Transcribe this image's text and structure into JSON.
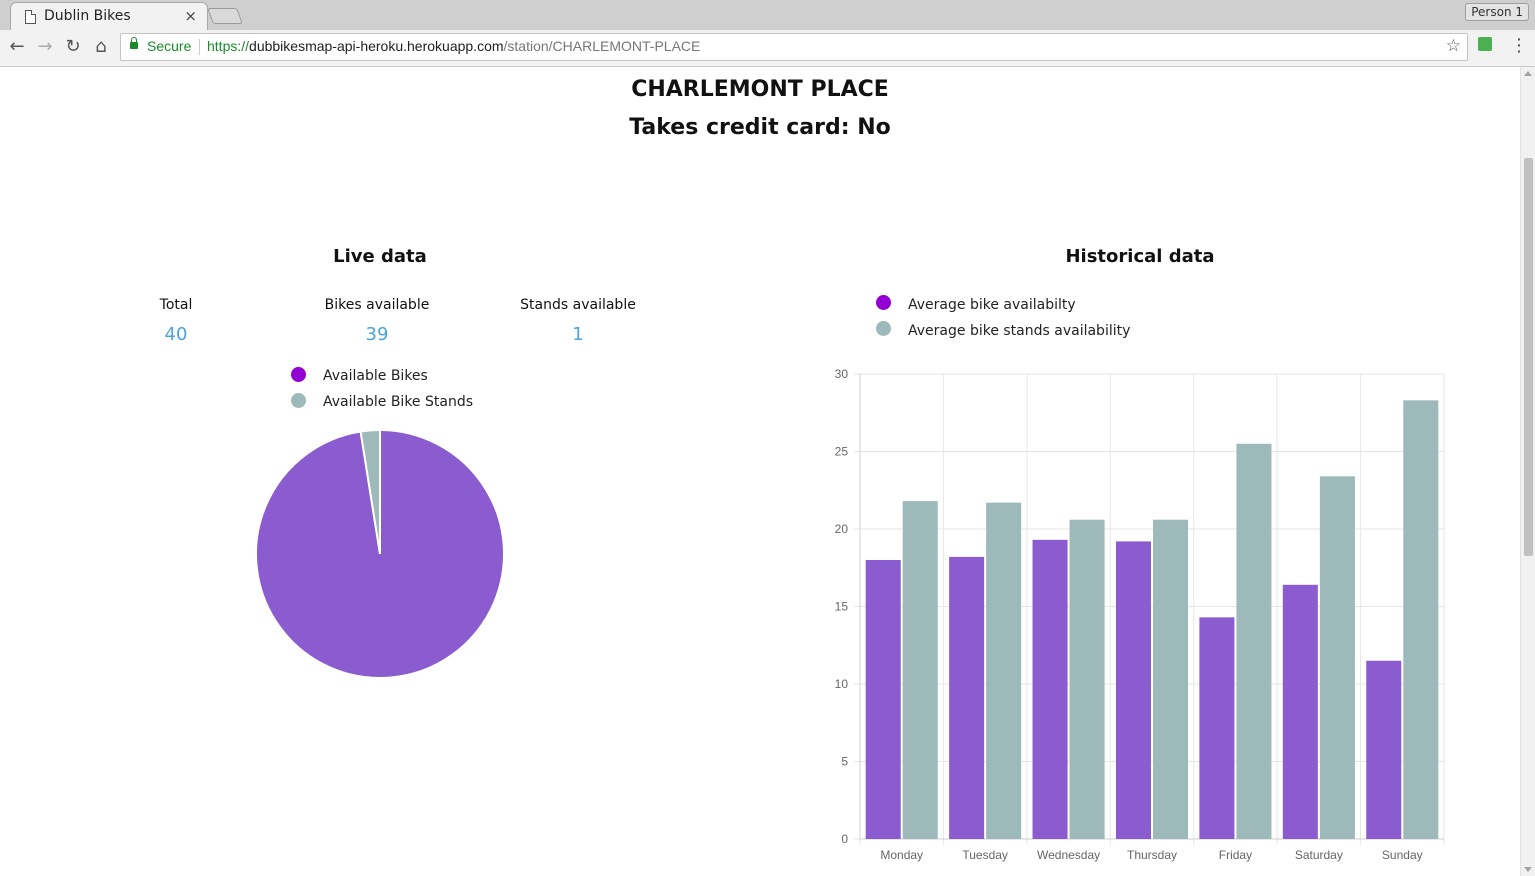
{
  "browser": {
    "tab_title": "Dublin Bikes",
    "tab_close": "×",
    "profile": "Person 1",
    "secure_label": "Secure",
    "url_scheme": "https://",
    "url_host": "dubbikesmap-api-heroku.herokuapp.com",
    "url_path": "/station/CHARLEMONT-PLACE"
  },
  "station": {
    "name": "CHARLEMONT PLACE",
    "credit_card": "Takes credit card: No"
  },
  "live": {
    "heading": "Live data",
    "stats": [
      {
        "label": "Total",
        "value": "40"
      },
      {
        "label": "Bikes available",
        "value": "39"
      },
      {
        "label": "Stands available",
        "value": "1"
      }
    ],
    "legend": [
      "Available Bikes",
      "Available Bike Stands"
    ]
  },
  "historical": {
    "heading": "Historical data",
    "legend": [
      "Average bike availabilty",
      "Average bike stands availability"
    ]
  },
  "colors": {
    "bikes": "#8b5bd0",
    "bikes_legend": "#9400d3",
    "stands": "#9db9b9",
    "value_blue": "#4aa3df"
  },
  "chart_data": [
    {
      "type": "pie",
      "labels": [
        "Available Bikes",
        "Available Bike Stands"
      ],
      "values": [
        39,
        1
      ]
    },
    {
      "type": "bar",
      "categories": [
        "Monday",
        "Tuesday",
        "Wednesday",
        "Thursday",
        "Friday",
        "Saturday",
        "Sunday"
      ],
      "series": [
        {
          "name": "Average bike availabilty",
          "values": [
            18.0,
            18.2,
            19.3,
            19.2,
            14.3,
            16.4,
            11.5
          ]
        },
        {
          "name": "Average bike stands availability",
          "values": [
            21.8,
            21.7,
            20.6,
            20.6,
            25.5,
            23.4,
            28.3
          ]
        }
      ],
      "ylim": [
        0,
        30
      ],
      "yticks": [
        0,
        5,
        10,
        15,
        20,
        25,
        30
      ],
      "grid": true,
      "legend": "top-left"
    }
  ]
}
